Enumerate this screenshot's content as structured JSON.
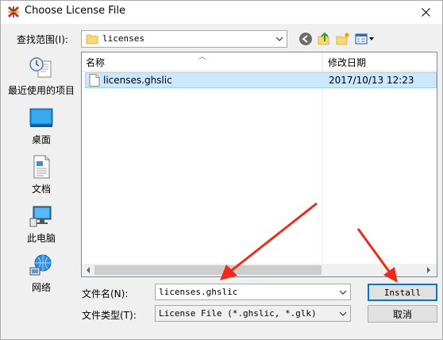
{
  "window": {
    "title": "Choose License File"
  },
  "lookin": {
    "label": "查找范围(I):",
    "value": "licenses"
  },
  "places": [
    {
      "label": "最近使用的项目",
      "icon": "recent-places-icon"
    },
    {
      "label": "桌面",
      "icon": "desktop-icon"
    },
    {
      "label": "文档",
      "icon": "documents-icon"
    },
    {
      "label": "此电脑",
      "icon": "this-pc-icon"
    },
    {
      "label": "网络",
      "icon": "network-icon"
    }
  ],
  "filelist": {
    "col_name": "名称",
    "col_date": "修改日期",
    "rows": [
      {
        "name": "licenses.ghslic",
        "date": "2017/10/13 12:23"
      }
    ]
  },
  "form": {
    "filename_label": "文件名(N):",
    "filename_value": "licenses.ghslic",
    "filetype_label": "文件类型(T):",
    "filetype_value": "License File (*.ghslic, *.glk)"
  },
  "buttons": {
    "install": "Install",
    "cancel": "取消"
  },
  "colors": {
    "selection": "#cce8ff",
    "accent": "#0078d7",
    "annotation_arrow": "#ee2b1a"
  }
}
